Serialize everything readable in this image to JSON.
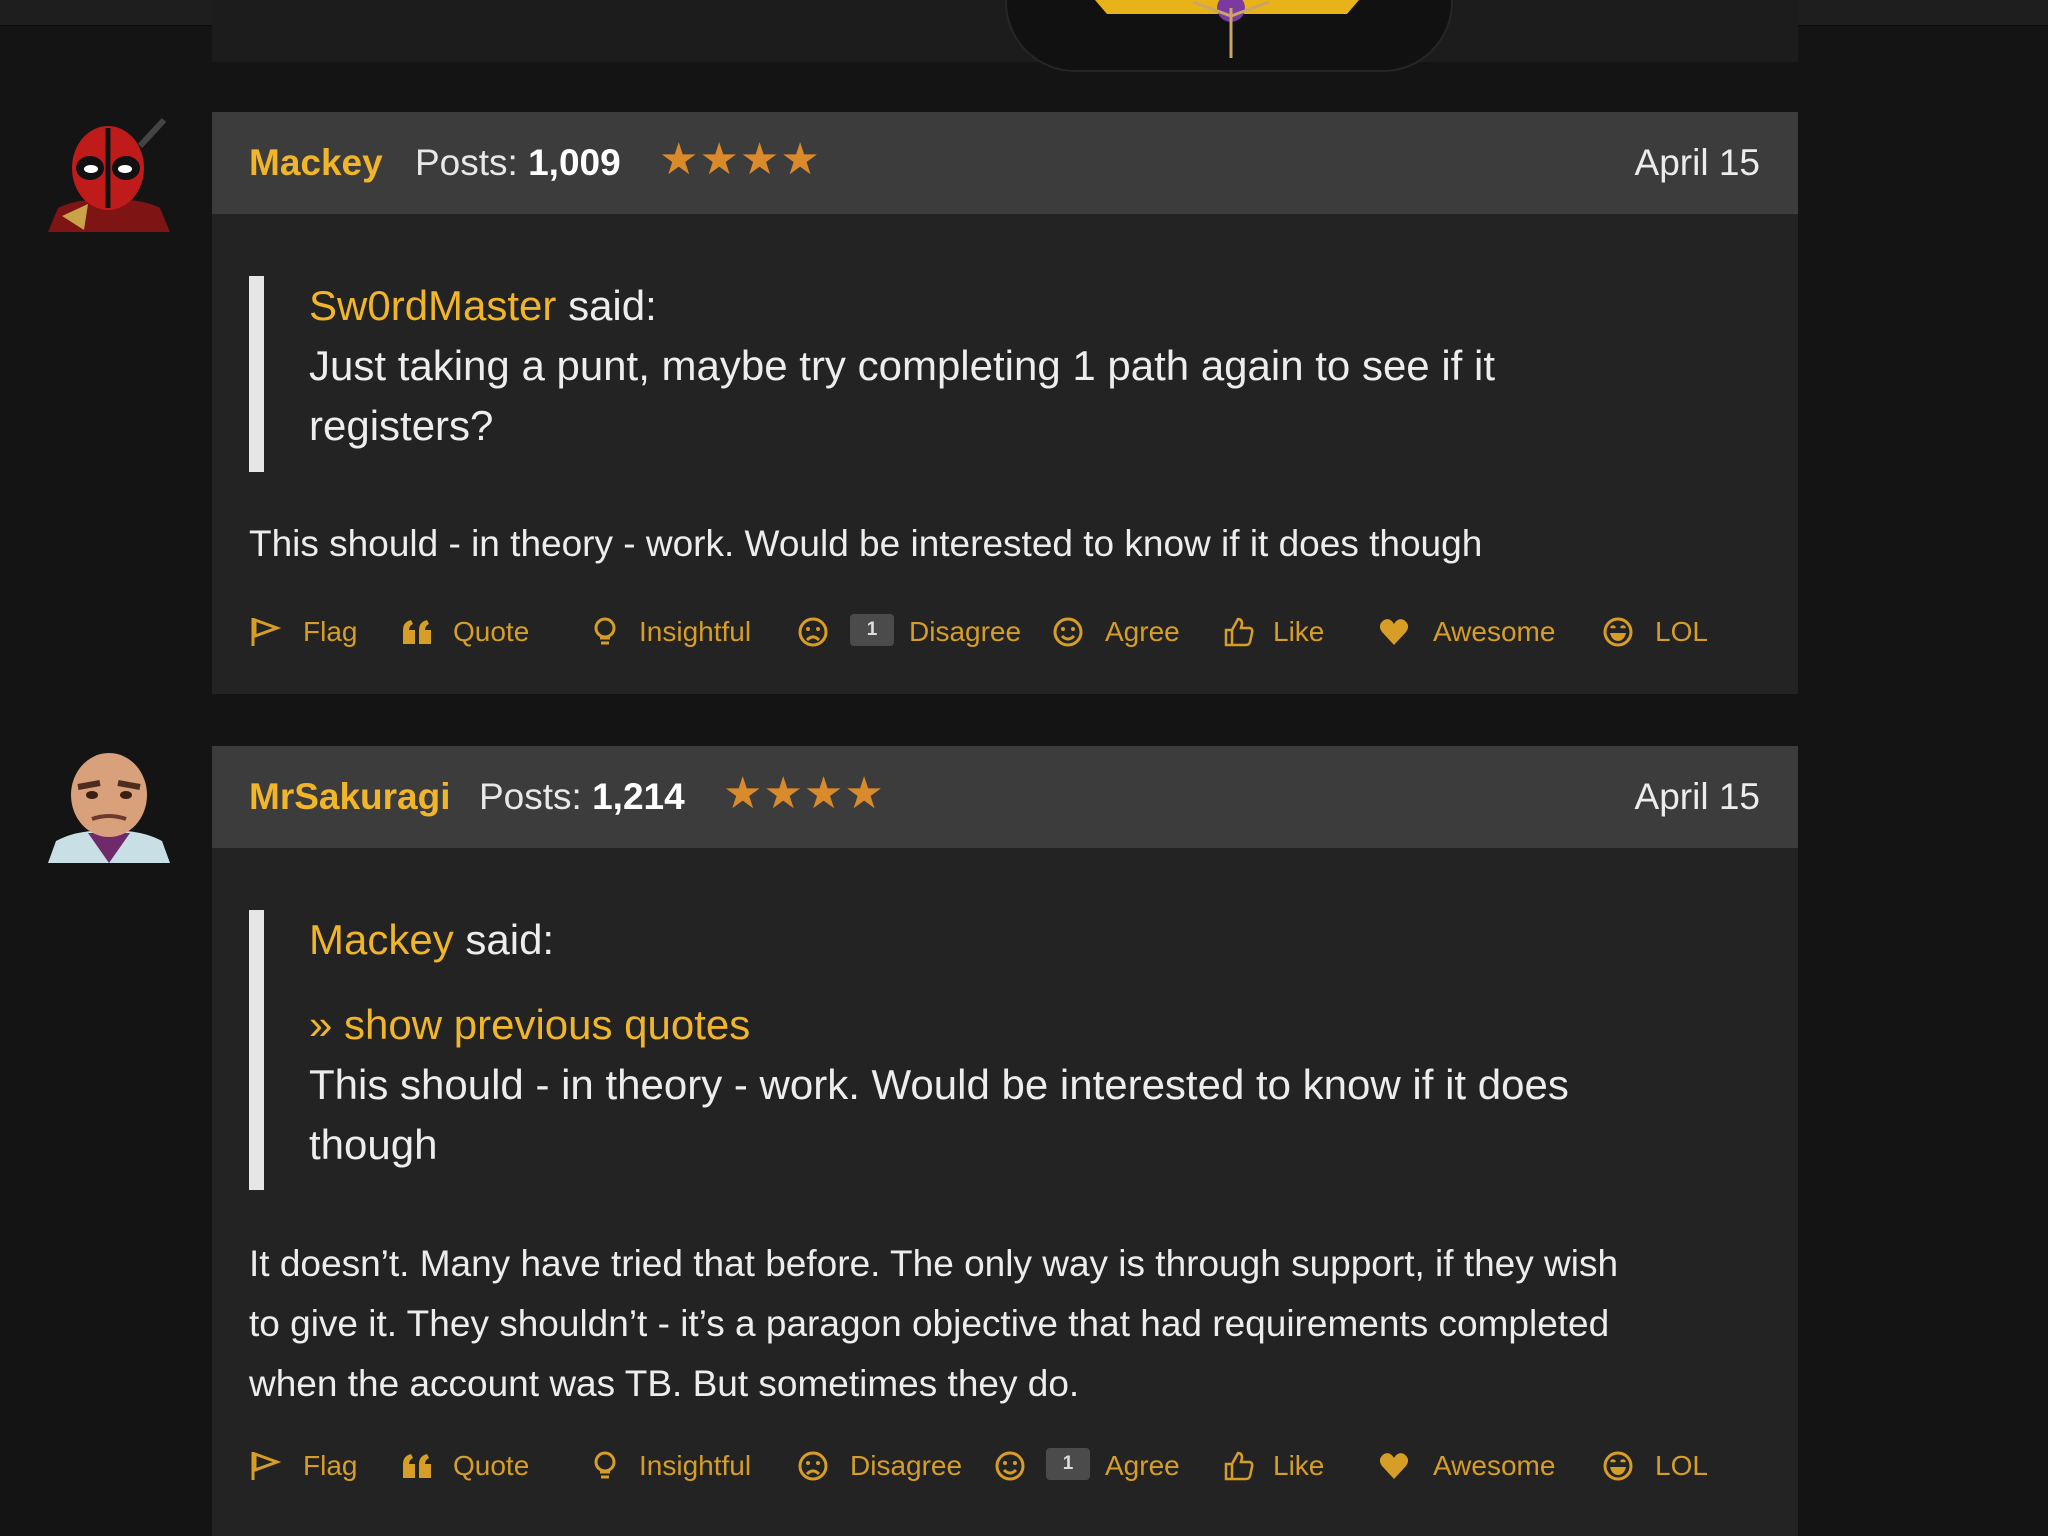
{
  "posts": [
    {
      "author": "Mackey",
      "posts_label": "Posts:",
      "post_count": "1,009",
      "stars": "★★★★",
      "date": "April 15",
      "quote": {
        "author": "Sw0rdMaster",
        "said": "said:",
        "lines": [
          "Just taking a punt, maybe try completing 1 path again to see if it",
          "registers?"
        ]
      },
      "body": [
        "This should - in theory - work. Would be interested to know if it does though"
      ],
      "actions": {
        "flag": "Flag",
        "quote": "Quote",
        "insightful": "Insightful",
        "disagree": "Disagree",
        "disagree_count": "1",
        "agree": "Agree",
        "like": "Like",
        "awesome": "Awesome",
        "lol": "LOL"
      }
    },
    {
      "author": "MrSakuragi",
      "posts_label": "Posts:",
      "post_count": "1,214",
      "stars": "★★★★",
      "date": "April 15",
      "quote": {
        "author": "Mackey",
        "said": "said:",
        "show_previous": "» show previous quotes",
        "lines": [
          "This should - in theory - work. Would be interested to know if it does",
          "though"
        ]
      },
      "body": [
        "It doesn’t. Many have tried that before. The only way is through support, if they wish",
        "to give it. They shouldn’t - it’s a paragon objective that had requirements completed",
        "when the account was TB. But sometimes they do."
      ],
      "actions": {
        "flag": "Flag",
        "quote": "Quote",
        "insightful": "Insightful",
        "disagree": "Disagree",
        "agree_count": "1",
        "agree": "Agree",
        "like": "Like",
        "awesome": "Awesome",
        "lol": "LOL"
      }
    }
  ],
  "colors": {
    "username": "#f1b52a",
    "action": "#d69d27",
    "stars": "#d98b2b",
    "card_bg": "#232323",
    "card_header_bg": "#3c3c3c"
  },
  "icons": [
    "flag-icon",
    "quote-icon",
    "lightbulb-icon",
    "frown-icon",
    "smile-icon",
    "thumbs-up-icon",
    "heart-icon",
    "laugh-icon"
  ]
}
